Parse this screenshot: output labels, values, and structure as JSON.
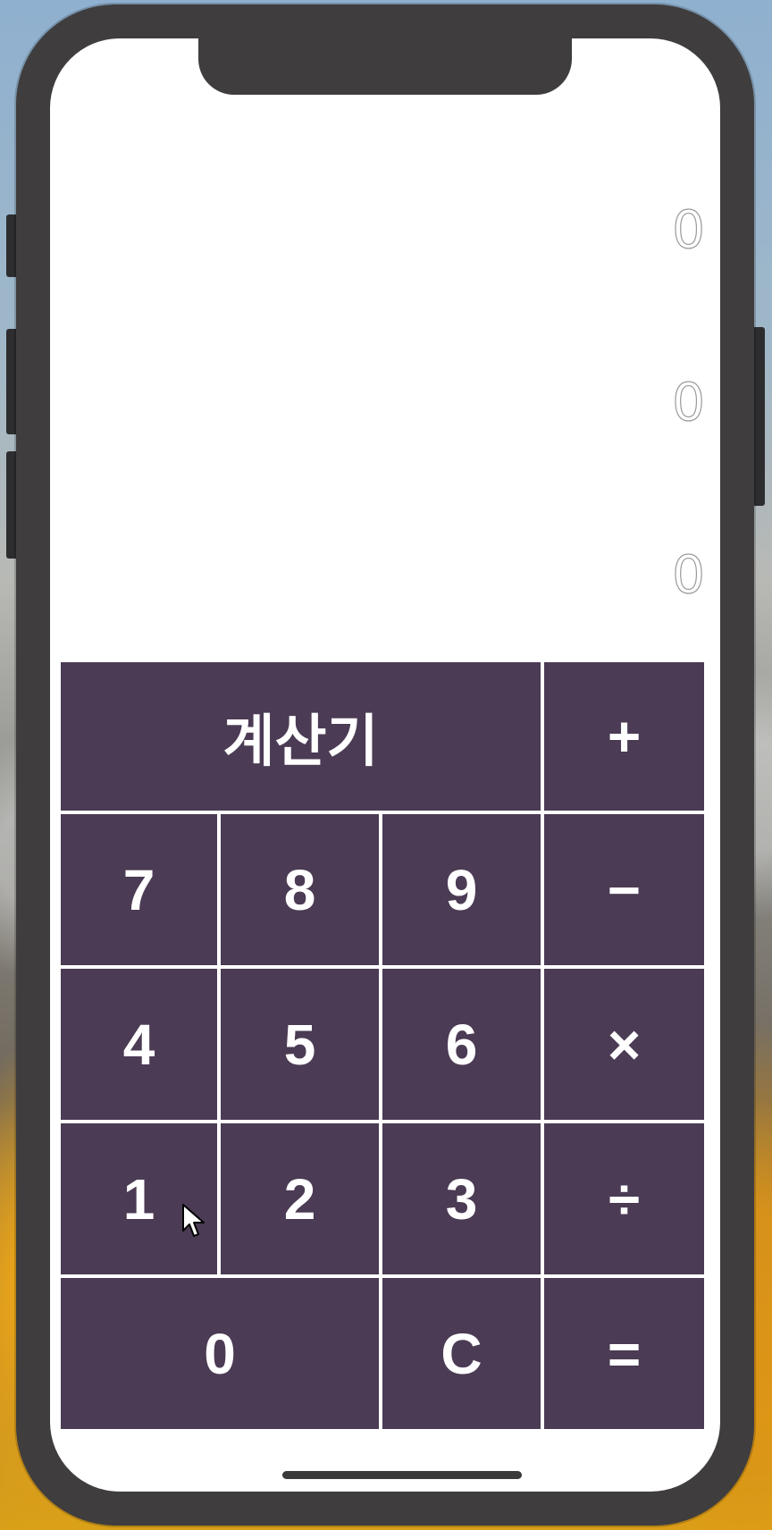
{
  "app": {
    "display_lines": [
      "0",
      "0",
      "0"
    ],
    "title_button": "계산기"
  },
  "keypad": {
    "operators": {
      "plus": "+",
      "minus": "−",
      "multiply": "×",
      "divide": "÷",
      "equals": "="
    },
    "digits": {
      "seven": "7",
      "eight": "8",
      "nine": "9",
      "four": "4",
      "five": "5",
      "six": "6",
      "one": "1",
      "two": "2",
      "three": "3",
      "zero": "0"
    },
    "clear": "C"
  },
  "colors": {
    "key_background": "#4b3b54",
    "key_text": "#ffffff",
    "screen_background": "#ffffff",
    "device_frame": "#3f3d3e"
  },
  "icons": {
    "pointer": "mouse-pointer-icon"
  }
}
